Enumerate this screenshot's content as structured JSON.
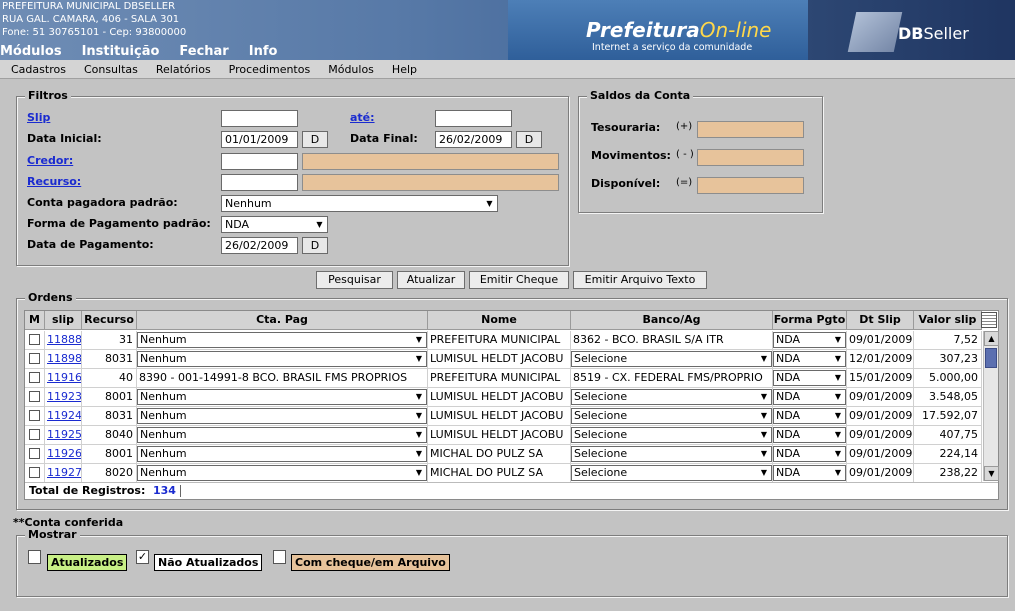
{
  "header": {
    "org_name": "PREFEITURA MUNICIPAL DBSELLER",
    "org_address": "RUA GAL. CAMARA, 406 - SALA 301",
    "org_contact": "Fone: 51 30765101  -  Cep: 93800000",
    "brand_title_main": "Prefeitura",
    "brand_title_accent": "On-line",
    "brand_subtitle": "Internet a serviço da comunidade",
    "seller_name_bold": "DB",
    "seller_name_thin": "Seller"
  },
  "main_menu": [
    "Módulos",
    "Instituição",
    "Fechar",
    "Info"
  ],
  "sub_menu": [
    "Cadastros",
    "Consultas",
    "Relatórios",
    "Procedimentos",
    "Módulos",
    "Help"
  ],
  "filtros": {
    "legend": "Filtros",
    "slip_label": "Slip",
    "ate_label": "até:",
    "data_inicial_label": "Data Inicial:",
    "data_inicial_value": "01/01/2009",
    "data_final_label": "Data Final:",
    "data_final_value": "26/02/2009",
    "credor_label": "Credor:",
    "recurso_label": "Recurso:",
    "conta_label": "Conta pagadora padrão:",
    "conta_value": "Nenhum",
    "forma_label": "Forma de Pagamento padrão:",
    "forma_value": "NDA",
    "data_pag_label": "Data de Pagamento:",
    "data_pag_value": "26/02/2009",
    "date_button": "D"
  },
  "saldos": {
    "legend": "Saldos da Conta",
    "tesouraria_label": "Tesouraria:",
    "tesouraria_sign": "(+)",
    "movimentos_label": "Movimentos:",
    "movimentos_sign": "( - )",
    "disponivel_label": "Disponível:",
    "disponivel_sign": "(=)"
  },
  "actions": {
    "pesquisar": "Pesquisar",
    "atualizar": "Atualizar",
    "emitir_cheque": "Emitir Cheque",
    "emitir_arquivo": "Emitir Arquivo Texto"
  },
  "ordens": {
    "legend": "Ordens",
    "columns": [
      "M",
      "slip",
      "Recurso",
      "Cta. Pag",
      "Nome",
      "Banco/Ag",
      "Forma Pgto",
      "Dt Slip",
      "Valor slip"
    ],
    "rows": [
      {
        "slip": "11888",
        "recurso": "31",
        "cta": "Nenhum",
        "cta_select": true,
        "nome": "PREFEITURA MUNICIPAL",
        "banco": "8362 - BCO. BRASIL S/A ITR",
        "banco_select": false,
        "forma": "NDA",
        "dt": "09/01/2009",
        "valor": "7,52"
      },
      {
        "slip": "11898",
        "recurso": "8031",
        "cta": "Nenhum",
        "cta_select": true,
        "nome": "LUMISUL HELDT JACOBU",
        "banco": "Selecione",
        "banco_select": true,
        "forma": "NDA",
        "dt": "12/01/2009",
        "valor": "307,23"
      },
      {
        "slip": "11916",
        "recurso": "40",
        "cta": "8390 - 001-14991-8 BCO. BRASIL FMS PROPRIOS",
        "cta_select": false,
        "nome": "PREFEITURA MUNICIPAL",
        "banco": "8519 - CX. FEDERAL FMS/PROPRIO",
        "banco_select": false,
        "forma": "NDA",
        "dt": "15/01/2009",
        "valor": "5.000,00"
      },
      {
        "slip": "11923",
        "recurso": "8001",
        "cta": "Nenhum",
        "cta_select": true,
        "nome": "LUMISUL HELDT JACOBU",
        "banco": "Selecione",
        "banco_select": true,
        "forma": "NDA",
        "dt": "09/01/2009",
        "valor": "3.548,05"
      },
      {
        "slip": "11924",
        "recurso": "8031",
        "cta": "Nenhum",
        "cta_select": true,
        "nome": "LUMISUL HELDT JACOBU",
        "banco": "Selecione",
        "banco_select": true,
        "forma": "NDA",
        "dt": "09/01/2009",
        "valor": "17.592,07"
      },
      {
        "slip": "11925",
        "recurso": "8040",
        "cta": "Nenhum",
        "cta_select": true,
        "nome": "LUMISUL HELDT JACOBU",
        "banco": "Selecione",
        "banco_select": true,
        "forma": "NDA",
        "dt": "09/01/2009",
        "valor": "407,75"
      },
      {
        "slip": "11926",
        "recurso": "8001",
        "cta": "Nenhum",
        "cta_select": true,
        "nome": "MICHAL DO PULZ SA",
        "banco": "Selecione",
        "banco_select": true,
        "forma": "NDA",
        "dt": "09/01/2009",
        "valor": "224,14"
      },
      {
        "slip": "11927",
        "recurso": "8020",
        "cta": "Nenhum",
        "cta_select": true,
        "nome": "MICHAL DO PULZ SA",
        "banco": "Selecione",
        "banco_select": true,
        "forma": "NDA",
        "dt": "09/01/2009",
        "valor": "238,22"
      }
    ],
    "total_label": "Total de Registros:",
    "total_value": "134"
  },
  "conta_conferida": "**Conta conferida",
  "mostrar": {
    "legend": "Mostrar",
    "atualizados": "Atualizados",
    "nao_atualizados": "Não Atualizados",
    "com_cheque": "Com cheque/em Arquivo",
    "atualizados_checked": false,
    "nao_atualizados_checked": true,
    "com_cheque_checked": false
  },
  "colors": {
    "readonly_field": "#e7c39b",
    "atualizados_bg": "#c8ef86",
    "nao_atualizados_bg": "#ffffff",
    "com_cheque_bg": "#e7c39b",
    "link": "#1a2bd0"
  }
}
